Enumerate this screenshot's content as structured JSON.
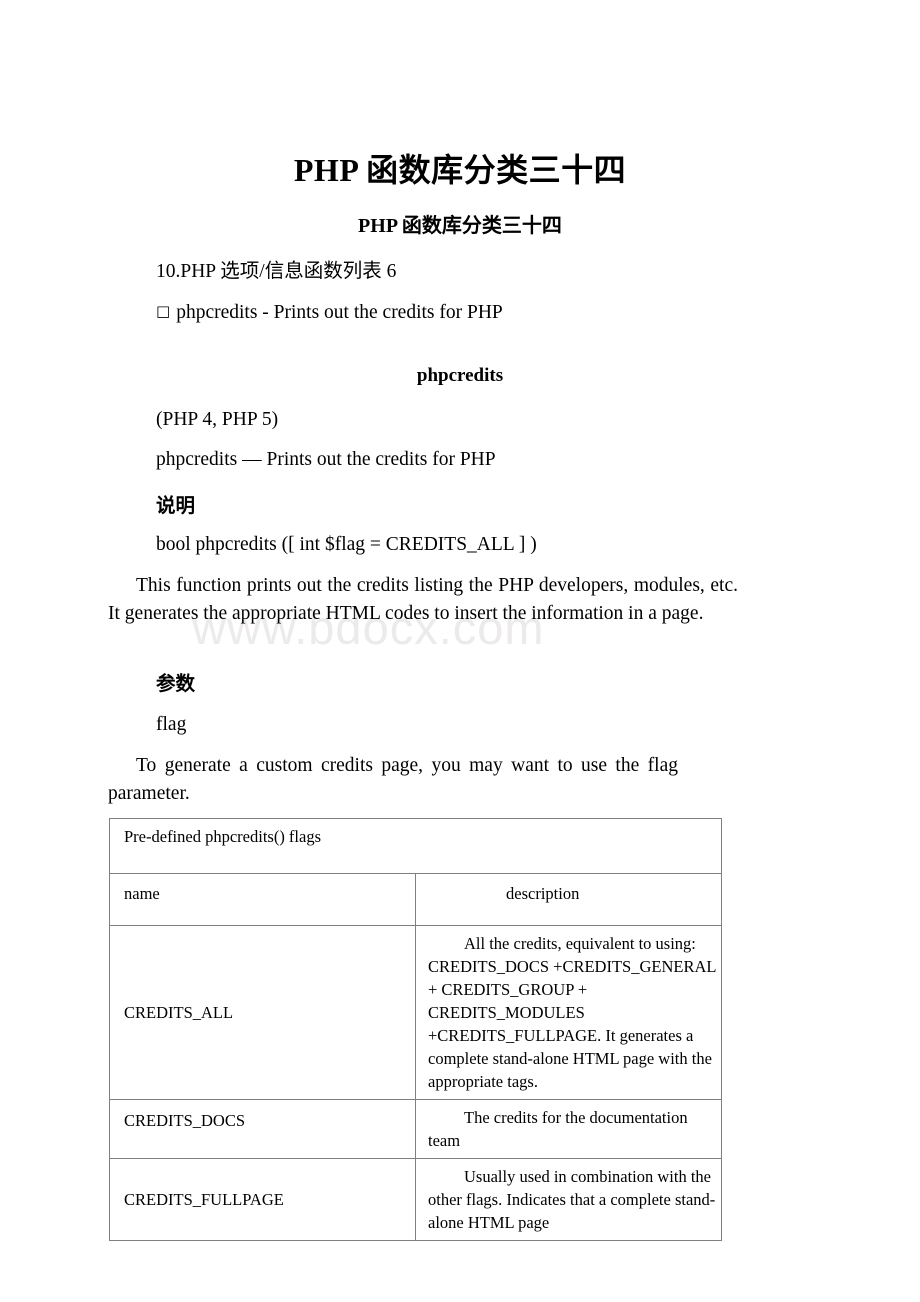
{
  "document": {
    "title_main": "PHP 函数库分类三十四",
    "title_sub": "PHP 函数库分类三十四",
    "section_line": "10.PHP 选项/信息函数列表 6",
    "bullet_glyph": "□",
    "bullet_item": "phpcredits - Prints out the credits for PHP",
    "function_heading": "phpcredits",
    "versions": "(PHP 4, PHP 5)",
    "summary_line": "phpcredits — Prints out the credits for PHP",
    "description_heading": "说明",
    "signature": "bool phpcredits ([ int $flag = CREDITS_ALL ] )",
    "description_body": "This function prints out the credits listing the PHP developers, modules, etc. It generates the appropriate HTML codes to insert the information in a page.",
    "parameters_heading": "参数",
    "parameter_name": "flag",
    "parameter_body": "To generate a custom credits page, you may want to use the flag parameter.",
    "watermark": "www.bdocx.com"
  },
  "table": {
    "caption": "Pre-defined phpcredits() flags",
    "columns": [
      "name",
      "description"
    ],
    "rows": [
      {
        "name": "CREDITS_ALL",
        "description": "All the credits, equivalent to using: CREDITS_DOCS +CREDITS_GENERAL + CREDITS_GROUP + CREDITS_MODULES +CREDITS_FULLPAGE. It generates a complete stand-alone HTML page with the appropriate tags."
      },
      {
        "name": "CREDITS_DOCS",
        "description": "The credits for the documentation team"
      },
      {
        "name": "CREDITS_FULLPAGE",
        "description": "Usually used in combination with the other flags. Indicates that a complete stand-alone HTML page"
      }
    ]
  }
}
